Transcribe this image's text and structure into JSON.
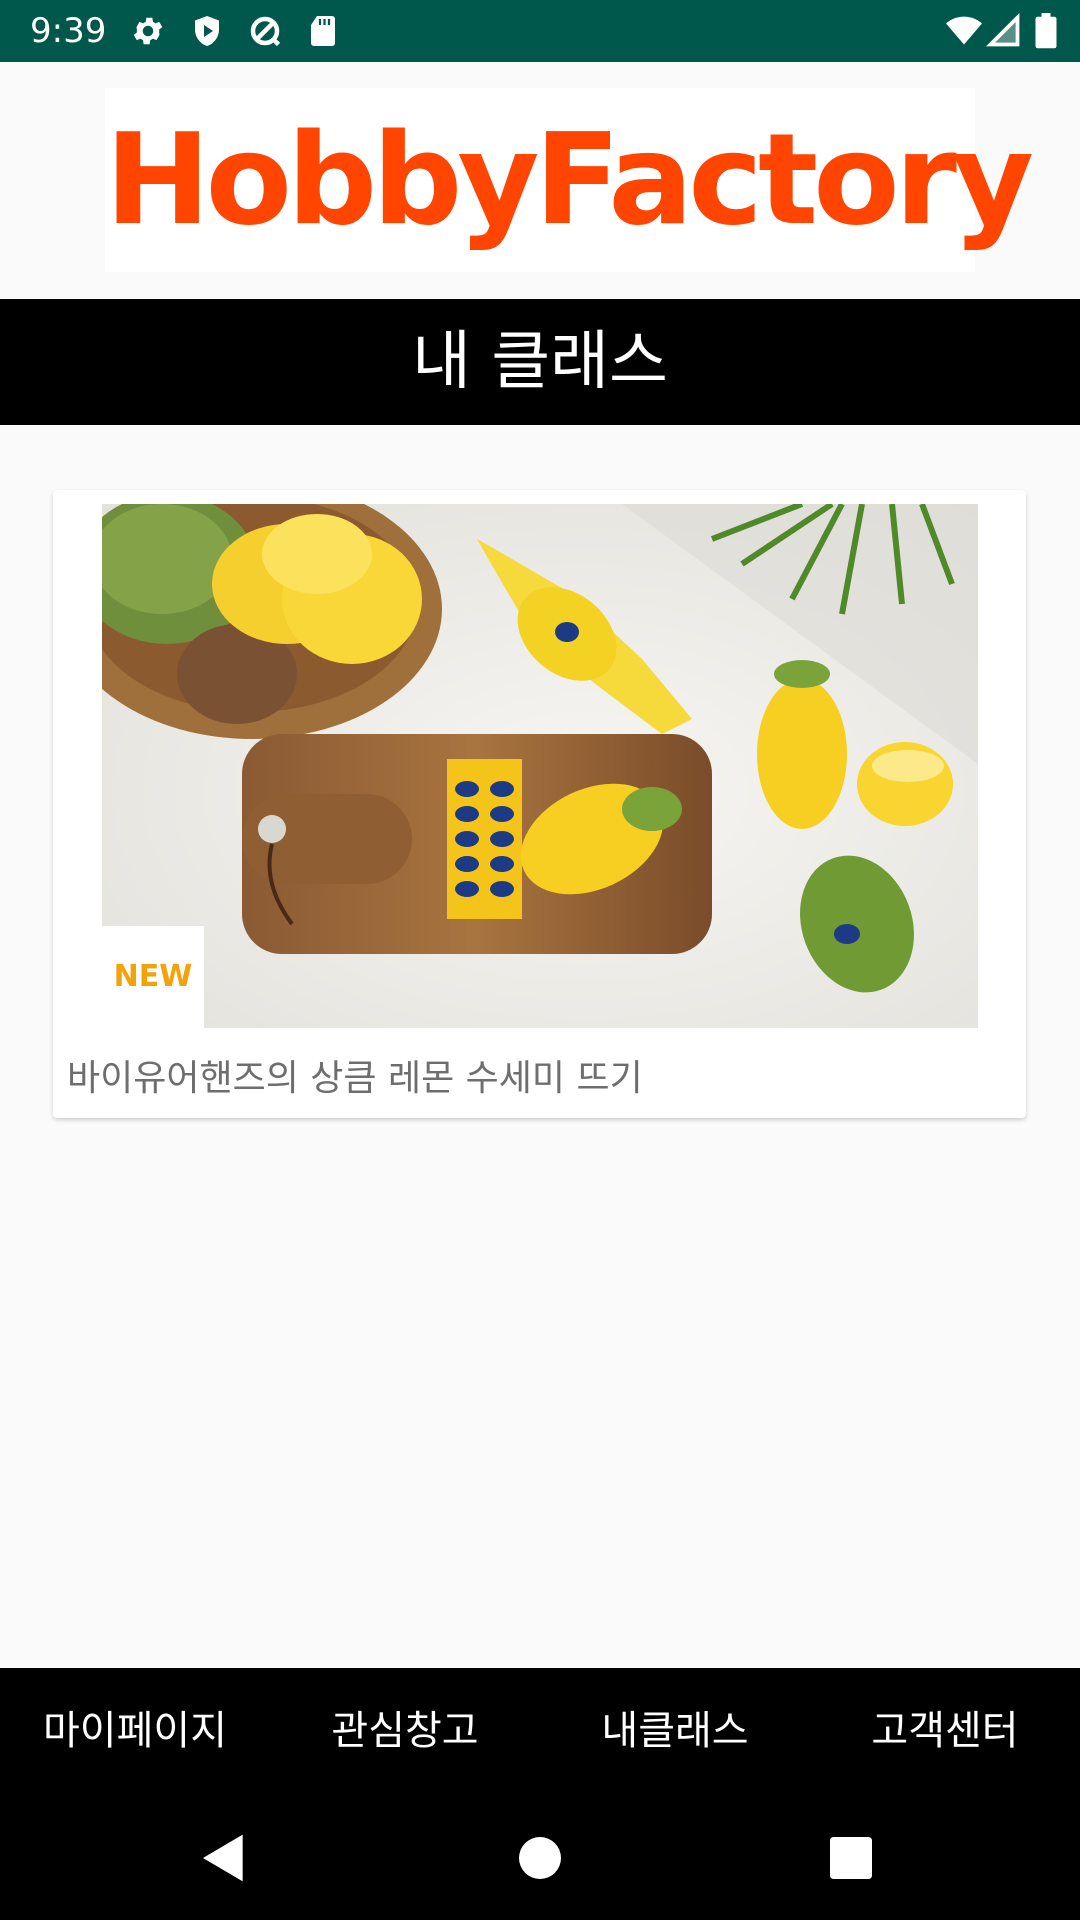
{
  "status_bar": {
    "time": "9:39",
    "icons": [
      "settings-icon",
      "shield-play-icon",
      "data-saver-icon",
      "sd-card-icon",
      "wifi-icon",
      "signal-icon",
      "battery-icon"
    ]
  },
  "logo": {
    "text": "HobbyFactory",
    "color": "#ff4500"
  },
  "page_title": "내 클래스",
  "classes": [
    {
      "title": "바이유어핸즈의 상큼 레몬 수세미 뜨기",
      "badge": "NEW"
    }
  ],
  "bottom_nav": {
    "items": [
      "마이페이지",
      "관심창고",
      "내클래스",
      "고객센터"
    ]
  },
  "system_nav": [
    "back-icon",
    "home-icon",
    "recents-icon"
  ],
  "colors": {
    "status_bar": "#00574b",
    "title_bar": "#000000",
    "background": "#fafafa",
    "badge_text": "#f2a20b"
  }
}
